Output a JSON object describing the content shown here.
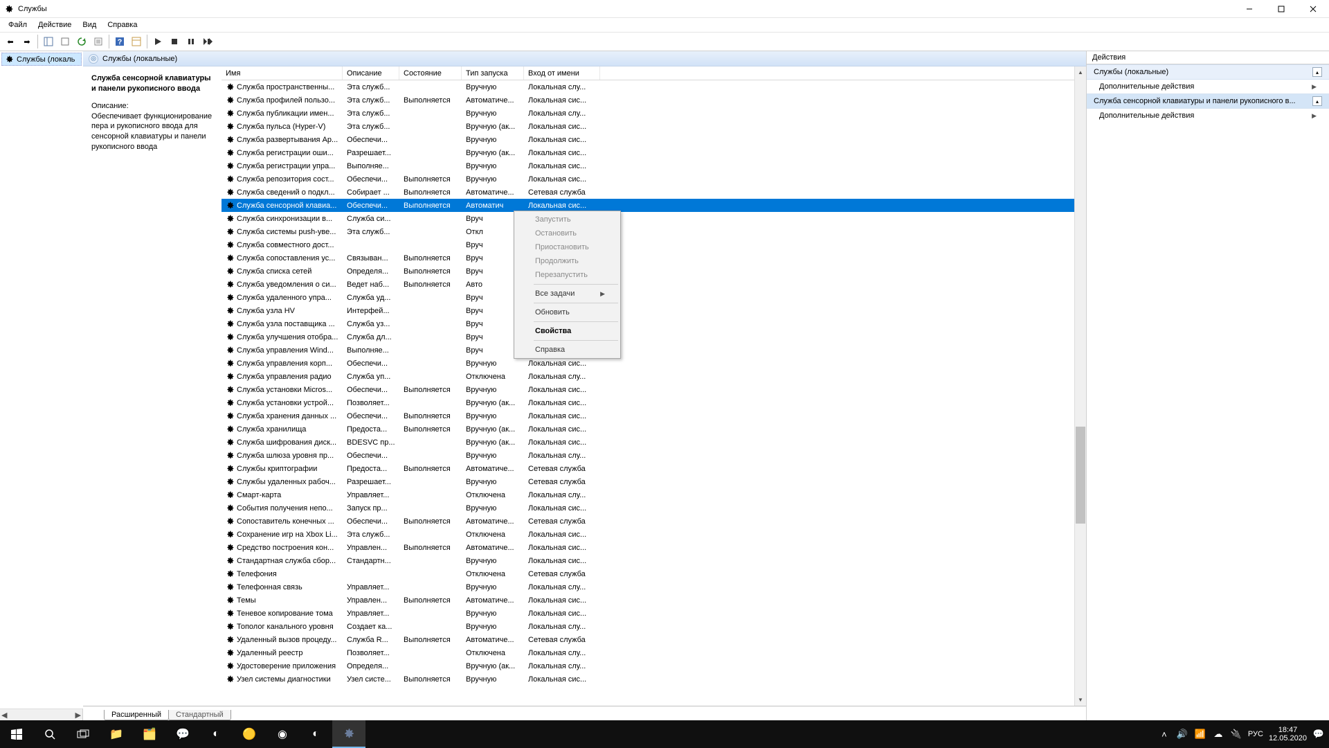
{
  "window_title": "Службы",
  "menu": {
    "file": "Файл",
    "action": "Действие",
    "view": "Вид",
    "help": "Справка"
  },
  "tree": {
    "root": "Службы (локаль"
  },
  "center_header": "Службы (локальные)",
  "detail": {
    "title": "Служба сенсорной клавиатуры и панели рукописного ввода",
    "desc_label": "Описание:",
    "desc": "Обеспечивает функционирование пера и рукописного ввода для сенсорной клавиатуры и панели рукописного ввода"
  },
  "columns": {
    "name": "Имя",
    "desc": "Описание",
    "state": "Состояние",
    "start": "Тип запуска",
    "logon": "Вход от имени"
  },
  "tabs": {
    "extended": "Расширенный",
    "standard": "Стандартный"
  },
  "actions": {
    "title": "Действия",
    "section1": "Службы (локальные)",
    "more": "Дополнительные действия",
    "section2": "Служба сенсорной клавиатуры и панели рукописного в..."
  },
  "context": {
    "start": "Запустить",
    "stop": "Остановить",
    "pause": "Приостановить",
    "resume": "Продолжить",
    "restart": "Перезапустить",
    "all_tasks": "Все задачи",
    "refresh": "Обновить",
    "properties": "Свойства",
    "help": "Справка"
  },
  "taskbar": {
    "lang": "РУС",
    "time": "18:47",
    "date": "12.05.2020"
  },
  "services": [
    {
      "name": "Служба пространственны...",
      "desc": "Эта служб...",
      "state": "",
      "start": "Вручную",
      "logon": "Локальная слу..."
    },
    {
      "name": "Служба профилей пользо...",
      "desc": "Эта служб...",
      "state": "Выполняется",
      "start": "Автоматиче...",
      "logon": "Локальная сис..."
    },
    {
      "name": "Служба публикации имен...",
      "desc": "Эта служб...",
      "state": "",
      "start": "Вручную",
      "logon": "Локальная слу..."
    },
    {
      "name": "Служба пульса (Hyper-V)",
      "desc": "Эта служб...",
      "state": "",
      "start": "Вручную (ак...",
      "logon": "Локальная сис..."
    },
    {
      "name": "Служба развертывания Ap...",
      "desc": "Обеспечи...",
      "state": "",
      "start": "Вручную",
      "logon": "Локальная сис..."
    },
    {
      "name": "Служба регистрации оши...",
      "desc": "Разрешает...",
      "state": "",
      "start": "Вручную (ак...",
      "logon": "Локальная сис..."
    },
    {
      "name": "Служба регистрации упра...",
      "desc": "Выполняе...",
      "state": "",
      "start": "Вручную",
      "logon": "Локальная сис..."
    },
    {
      "name": "Служба репозитория сост...",
      "desc": "Обеспечи...",
      "state": "Выполняется",
      "start": "Вручную",
      "logon": "Локальная сис..."
    },
    {
      "name": "Служба сведений о подкл...",
      "desc": "Собирает ...",
      "state": "Выполняется",
      "start": "Автоматиче...",
      "logon": "Сетевая служба"
    },
    {
      "name": "Служба сенсорной клавиа...",
      "desc": "Обеспечи...",
      "state": "Выполняется",
      "start": "Автоматич",
      "logon": "Локальная сис...",
      "sel": true
    },
    {
      "name": "Служба синхронизации в...",
      "desc": "Служба си...",
      "state": "",
      "start": "Вруч",
      "logon": ""
    },
    {
      "name": "Служба системы push-уве...",
      "desc": "Эта служб...",
      "state": "",
      "start": "Откл",
      "logon": ""
    },
    {
      "name": "Служба совместного дост...",
      "desc": "",
      "state": "",
      "start": "Вруч",
      "logon": ""
    },
    {
      "name": "Служба сопоставления ус...",
      "desc": "Связыван...",
      "state": "Выполняется",
      "start": "Вруч",
      "logon": ""
    },
    {
      "name": "Служба списка сетей",
      "desc": "Определя...",
      "state": "Выполняется",
      "start": "Вруч",
      "logon": ""
    },
    {
      "name": "Служба уведомления о си...",
      "desc": "Ведет наб...",
      "state": "Выполняется",
      "start": "Авто",
      "logon": ""
    },
    {
      "name": "Служба удаленного упра...",
      "desc": "Служба уд...",
      "state": "",
      "start": "Вруч",
      "logon": ""
    },
    {
      "name": "Служба узла HV",
      "desc": "Интерфей...",
      "state": "",
      "start": "Вруч",
      "logon": ""
    },
    {
      "name": "Служба узла поставщика ...",
      "desc": "Служба уз...",
      "state": "",
      "start": "Вруч",
      "logon": ""
    },
    {
      "name": "Служба улучшения отобра...",
      "desc": "Служба дл...",
      "state": "",
      "start": "Вруч",
      "logon": ""
    },
    {
      "name": "Служба управления Wind...",
      "desc": "Выполняе...",
      "state": "",
      "start": "Вруч",
      "logon": ""
    },
    {
      "name": "Служба управления корп...",
      "desc": "Обеспечи...",
      "state": "",
      "start": "Вручную",
      "logon": "Локальная сис..."
    },
    {
      "name": "Служба управления радио",
      "desc": "Служба уп...",
      "state": "",
      "start": "Отключена",
      "logon": "Локальная слу..."
    },
    {
      "name": "Служба установки Micros...",
      "desc": "Обеспечи...",
      "state": "Выполняется",
      "start": "Вручную",
      "logon": "Локальная сис..."
    },
    {
      "name": "Служба установки устрой...",
      "desc": "Позволяет...",
      "state": "",
      "start": "Вручную (ак...",
      "logon": "Локальная сис..."
    },
    {
      "name": "Служба хранения данных ...",
      "desc": "Обеспечи...",
      "state": "Выполняется",
      "start": "Вручную",
      "logon": "Локальная сис..."
    },
    {
      "name": "Служба хранилища",
      "desc": "Предоста...",
      "state": "Выполняется",
      "start": "Вручную (ак...",
      "logon": "Локальная сис..."
    },
    {
      "name": "Служба шифрования диск...",
      "desc": "BDESVC пр...",
      "state": "",
      "start": "Вручную (ак...",
      "logon": "Локальная сис..."
    },
    {
      "name": "Служба шлюза уровня пр...",
      "desc": "Обеспечи...",
      "state": "",
      "start": "Вручную",
      "logon": "Локальная слу..."
    },
    {
      "name": "Службы криптографии",
      "desc": "Предоста...",
      "state": "Выполняется",
      "start": "Автоматиче...",
      "logon": "Сетевая служба"
    },
    {
      "name": "Службы удаленных рабоч...",
      "desc": "Разрешает...",
      "state": "",
      "start": "Вручную",
      "logon": "Сетевая служба"
    },
    {
      "name": "Смарт-карта",
      "desc": "Управляет...",
      "state": "",
      "start": "Отключена",
      "logon": "Локальная слу..."
    },
    {
      "name": "События получения непо...",
      "desc": "Запуск пр...",
      "state": "",
      "start": "Вручную",
      "logon": "Локальная сис..."
    },
    {
      "name": "Сопоставитель конечных ...",
      "desc": "Обеспечи...",
      "state": "Выполняется",
      "start": "Автоматиче...",
      "logon": "Сетевая служба"
    },
    {
      "name": "Сохранение игр на Xbox Li...",
      "desc": "Эта служб...",
      "state": "",
      "start": "Отключена",
      "logon": "Локальная сис..."
    },
    {
      "name": "Средство построения кон...",
      "desc": "Управлен...",
      "state": "Выполняется",
      "start": "Автоматиче...",
      "logon": "Локальная сис..."
    },
    {
      "name": "Стандартная служба сбор...",
      "desc": "Стандартн...",
      "state": "",
      "start": "Вручную",
      "logon": "Локальная сис..."
    },
    {
      "name": "Телефония",
      "desc": "",
      "state": "",
      "start": "Отключена",
      "logon": "Сетевая служба"
    },
    {
      "name": "Телефонная связь",
      "desc": "Управляет...",
      "state": "",
      "start": "Вручную",
      "logon": "Локальная слу..."
    },
    {
      "name": "Темы",
      "desc": "Управлен...",
      "state": "Выполняется",
      "start": "Автоматиче...",
      "logon": "Локальная сис..."
    },
    {
      "name": "Теневое копирование тома",
      "desc": "Управляет...",
      "state": "",
      "start": "Вручную",
      "logon": "Локальная сис..."
    },
    {
      "name": "Тополог канального уровня",
      "desc": "Создает ка...",
      "state": "",
      "start": "Вручную",
      "logon": "Локальная слу..."
    },
    {
      "name": "Удаленный вызов процеду...",
      "desc": "Служба R...",
      "state": "Выполняется",
      "start": "Автоматиче...",
      "logon": "Сетевая служба"
    },
    {
      "name": "Удаленный реестр",
      "desc": "Позволяет...",
      "state": "",
      "start": "Отключена",
      "logon": "Локальная слу..."
    },
    {
      "name": "Удостоверение приложения",
      "desc": "Определя...",
      "state": "",
      "start": "Вручную (ак...",
      "logon": "Локальная слу..."
    },
    {
      "name": "Узел системы диагностики",
      "desc": "Узел систе...",
      "state": "Выполняется",
      "start": "Вручную",
      "logon": "Локальная сис..."
    }
  ]
}
